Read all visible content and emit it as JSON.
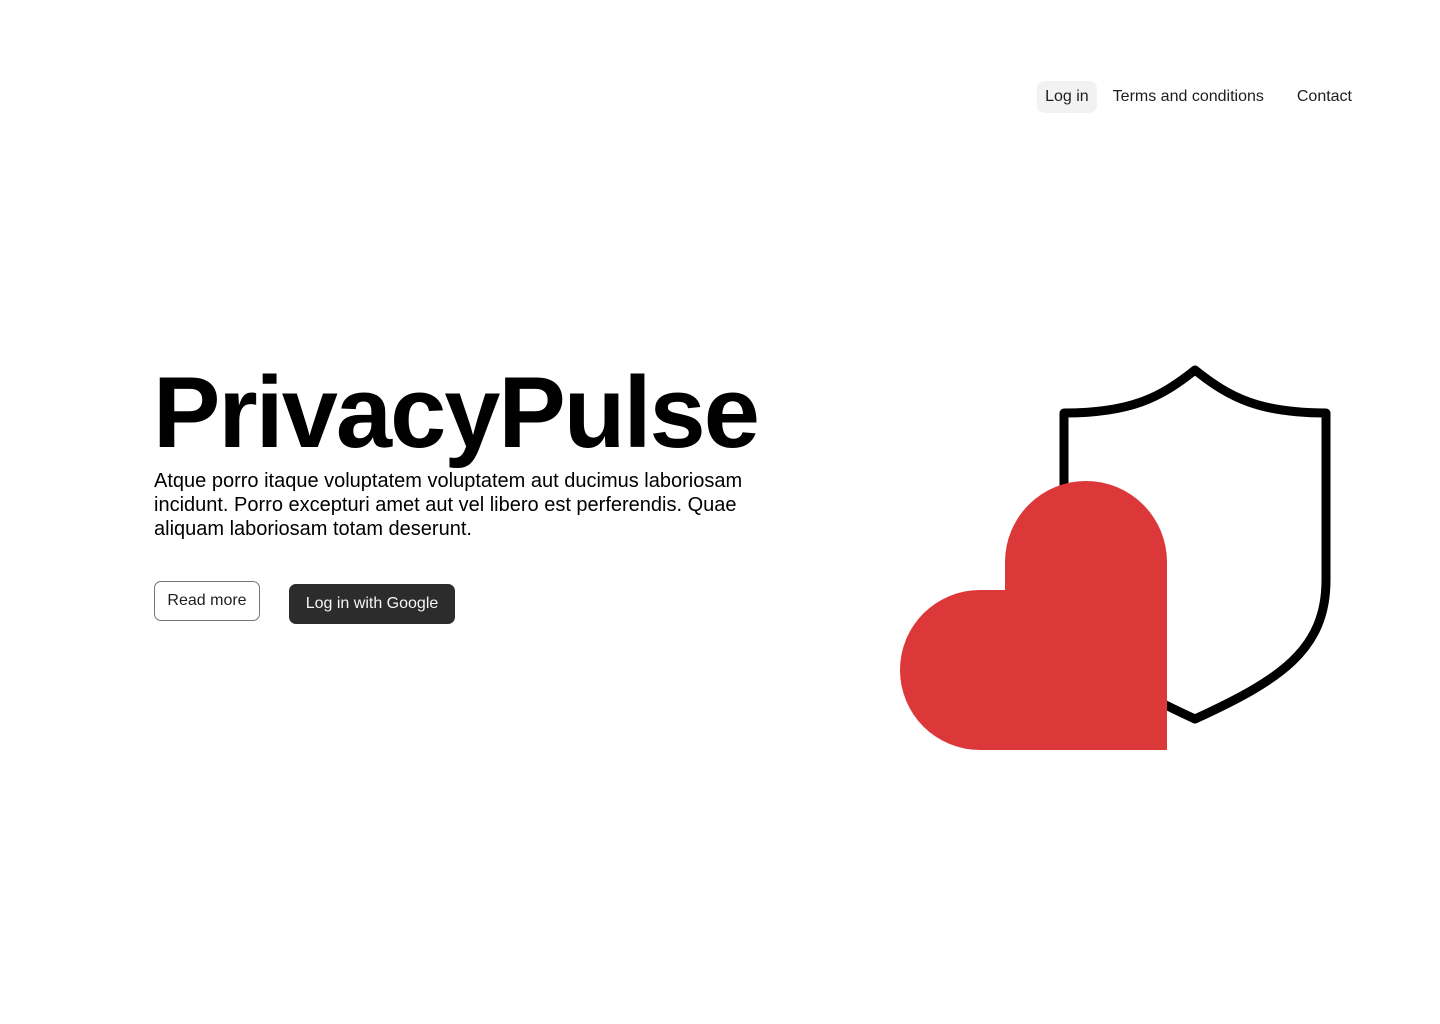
{
  "nav": {
    "items": [
      {
        "label": "Log in",
        "active": true
      },
      {
        "label": "Terms and conditions",
        "active": false
      },
      {
        "label": "Contact",
        "active": false
      }
    ]
  },
  "hero": {
    "title": "PrivacyPulse",
    "description": "Atque porro itaque voluptatem voluptatem aut ducimus laboriosam incidunt. Porro excepturi amet aut vel libero est perferendis. Quae aliquam laboriosam totam deserunt.",
    "read_more_label": "Read more",
    "google_login_label": "Log in with Google"
  },
  "illustration": {
    "icons": [
      "shield-icon",
      "heart-icon"
    ],
    "heart_color": "#dc383a",
    "shield_stroke_color": "#000000"
  },
  "colors": {
    "primary_button": "#2c2c2c",
    "active_nav_bg": "#f2f2f2"
  }
}
